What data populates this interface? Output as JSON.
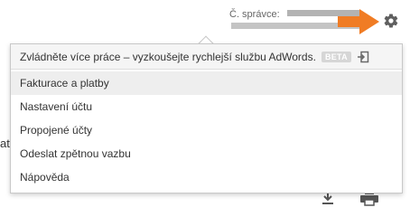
{
  "header": {
    "account_label": "Č. správce:",
    "settings_icon": "gear-icon",
    "arrow_color": "#f07c24"
  },
  "background": {
    "left_text": "atb",
    "icons": [
      "download-icon",
      "print-icon"
    ]
  },
  "menu": {
    "promo_text": "Zvládněte více práce – vyzkoušejte rychlejší službu AdWords.",
    "badge": "BETA",
    "promo_icon": "exit-icon",
    "items": [
      {
        "label": "Fakturace a platby",
        "selected": true
      },
      {
        "label": "Nastavení účtu",
        "selected": false
      },
      {
        "label": "Propojené účty",
        "selected": false
      },
      {
        "label": "Odeslat zpětnou vazbu",
        "selected": false
      },
      {
        "label": "Nápověda",
        "selected": false
      }
    ]
  }
}
